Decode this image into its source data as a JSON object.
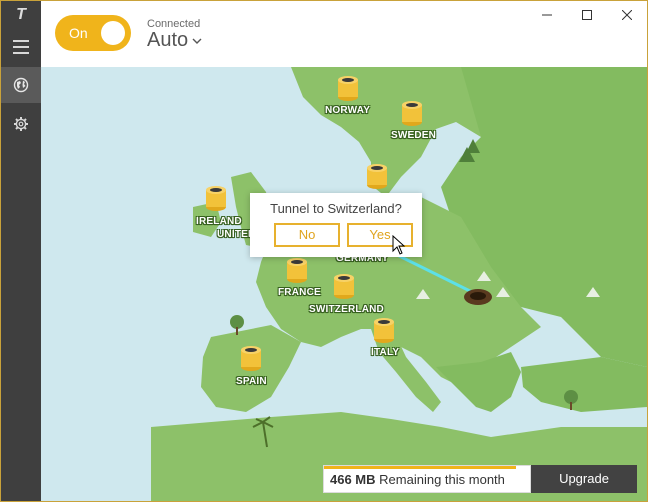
{
  "window": {
    "logo_text": "T",
    "controls": [
      "minimize",
      "maximize",
      "close"
    ]
  },
  "header": {
    "toggle_label": "On",
    "toggle_state": true,
    "status": "Connected",
    "location": "Auto"
  },
  "sidebar": {
    "items": [
      {
        "name": "menu",
        "icon": "hamburger-icon"
      },
      {
        "name": "map",
        "icon": "globe-icon",
        "active": true
      },
      {
        "name": "settings",
        "icon": "gear-icon"
      }
    ]
  },
  "map": {
    "countries": [
      {
        "label": "NORWAY"
      },
      {
        "label": "SWEDEN"
      },
      {
        "label": "IRELAND"
      },
      {
        "label": "UNITED KI"
      },
      {
        "label": "GERMANY"
      },
      {
        "label": "FRANCE"
      },
      {
        "label": "SWITZERLAND"
      },
      {
        "label": "ITALY"
      },
      {
        "label": "SPAIN"
      }
    ]
  },
  "dialog": {
    "title": "Tunnel to Switzerland?",
    "no_label": "No",
    "yes_label": "Yes"
  },
  "data_usage": {
    "amount": "466 MB",
    "text": "Remaining this month",
    "fraction_remaining": 0.93
  },
  "upgrade_label": "Upgrade",
  "colors": {
    "accent": "#f0b41b",
    "sidebar": "#3f3f3f",
    "sea": "#cfe8ee",
    "land": "#8dc169",
    "tunnel": "#5ce0e8"
  }
}
